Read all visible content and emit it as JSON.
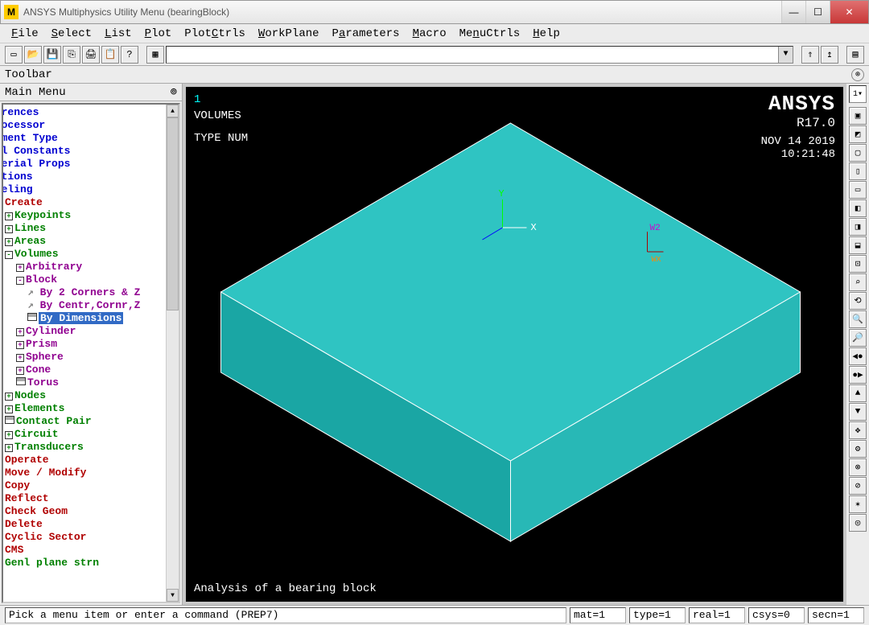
{
  "window": {
    "title": "ANSYS Multiphysics Utility Menu (bearingBlock)",
    "logo": "M"
  },
  "menubar": [
    "File",
    "Select",
    "List",
    "Plot",
    "PlotCtrls",
    "WorkPlane",
    "Parameters",
    "Macro",
    "MenuCtrls",
    "Help"
  ],
  "toolbar_label": "Toolbar",
  "main_menu_label": "Main Menu",
  "tree": {
    "top": [
      "ferences",
      "processor",
      "lement Type",
      "eal Constants",
      "aterial Props",
      "ections",
      "odeling"
    ],
    "create": "Create",
    "create_children": [
      "Keypoints",
      "Lines",
      "Areas"
    ],
    "volumes": "Volumes",
    "vol_children": {
      "arbitrary": "Arbitrary",
      "block": "Block"
    },
    "block_children": [
      "By 2 Corners & Z",
      "By Centr,Cornr,Z",
      "By Dimensions"
    ],
    "shapes": [
      "Cylinder",
      "Prism",
      "Sphere",
      "Cone",
      "Torus"
    ],
    "after_vol": [
      "Nodes",
      "Elements",
      "Contact Pair",
      "Circuit",
      "Transducers"
    ],
    "ops": [
      "Operate",
      "Move / Modify",
      "Copy",
      "Reflect",
      "Check Geom",
      "Delete",
      "Cyclic Sector",
      "CMS",
      "Genl plane strn"
    ]
  },
  "gfx": {
    "one": "1",
    "volumes": "VOLUMES",
    "typenum": "TYPE NUM",
    "brand": "ANSYS",
    "version": "R17.0",
    "date": "NOV 14 2019",
    "time": "10:21:48",
    "axis_x": "X",
    "axis_y": "Y",
    "wp": "W2",
    "wp2": "WX",
    "caption": "Analysis of a bearing block"
  },
  "right_combo": "1",
  "status": {
    "prompt": "Pick a menu item or enter a command (PREP7)",
    "mat": "mat=1",
    "type": "type=1",
    "real": "real=1",
    "csys": "csys=0",
    "secn": "secn=1"
  }
}
